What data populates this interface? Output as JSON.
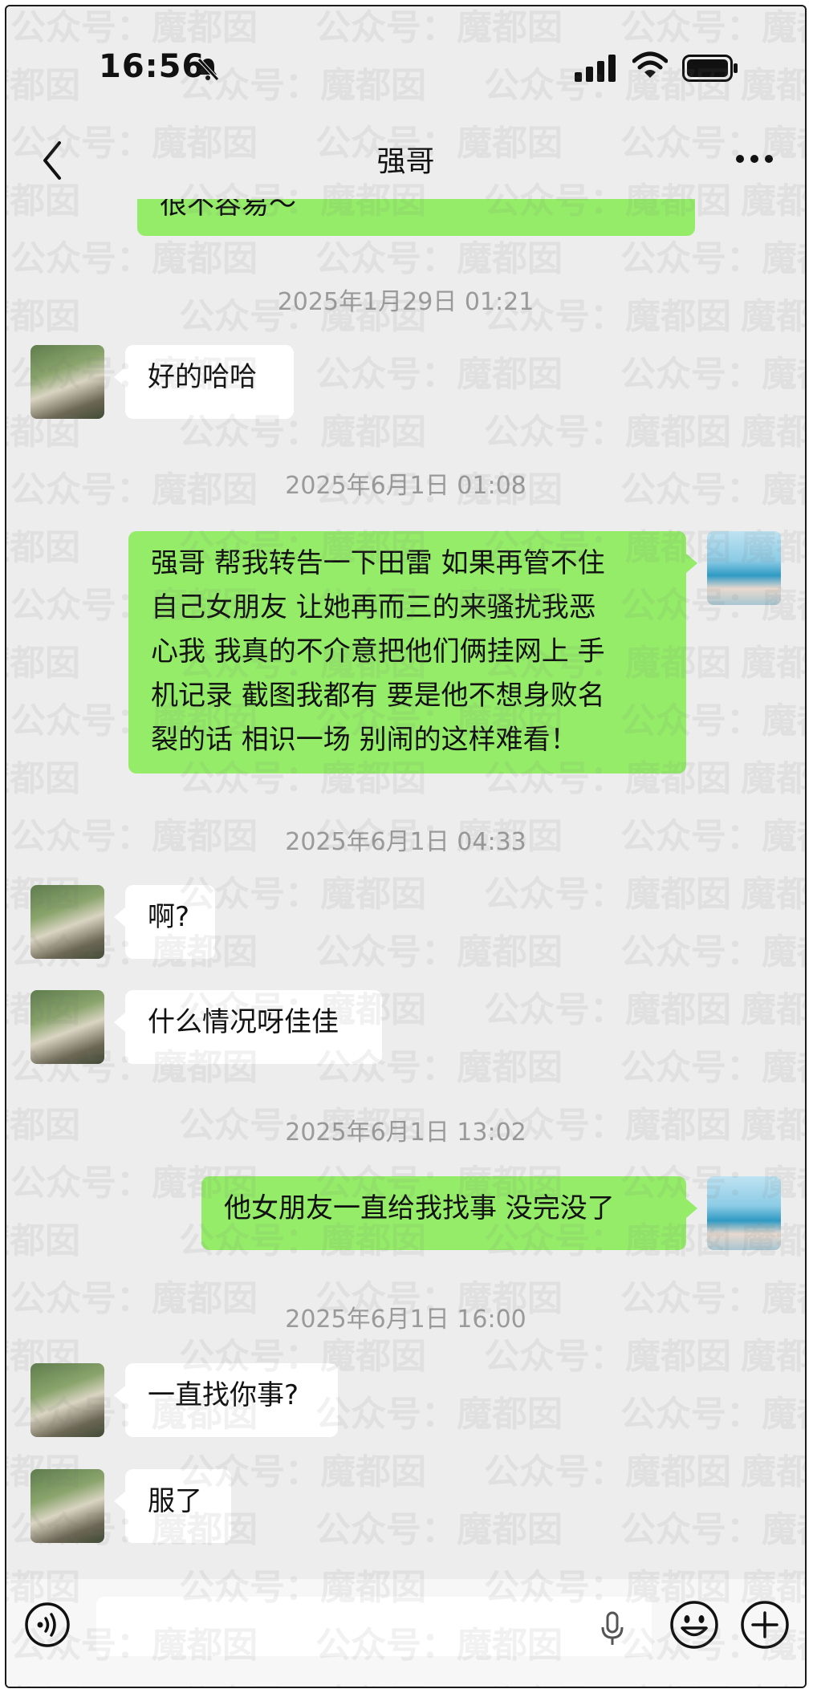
{
  "status_bar": {
    "time": "16:56"
  },
  "header": {
    "title": "强哥",
    "back_icon": "chevron-left-icon",
    "more_icon": "ellipsis-icon"
  },
  "messages": {
    "m0_text": "很不容易～",
    "ts1": "2025年1月29日 01:21",
    "m1_text": "好的哈哈",
    "ts2": "2025年6月1日 01:08",
    "m2_lines": [
      "强哥 帮我转告一下田雷 如果再管不住",
      "自己女朋友 让她再而三的来骚扰我恶",
      "心我 我真的不介意把他们俩挂网上 手",
      "机记录 截图我都有 要是他不想身败名",
      "裂的话 相识一场 别闹的这样难看！"
    ],
    "ts3": "2025年6月1日 04:33",
    "m3_text": "啊?",
    "m4_text": "什么情况呀佳佳",
    "ts4": "2025年6月1日 13:02",
    "m5_text": "他女朋友一直给我找事 没完没了",
    "ts5": "2025年6月1日 16:00",
    "m6_text": "一直找你事?",
    "m7_text": "服了"
  },
  "watermark": {
    "text_a": "公众号：",
    "text_b": "魔都囡"
  },
  "colors": {
    "outgoing_bubble": "#95ec69",
    "incoming_bubble": "#ffffff",
    "background": "#ededed"
  },
  "input_bar": {
    "voice_icon": "voice-icon",
    "mic_icon": "microphone-icon",
    "emoji_icon": "emoji-icon",
    "plus_icon": "plus-circle-icon"
  }
}
